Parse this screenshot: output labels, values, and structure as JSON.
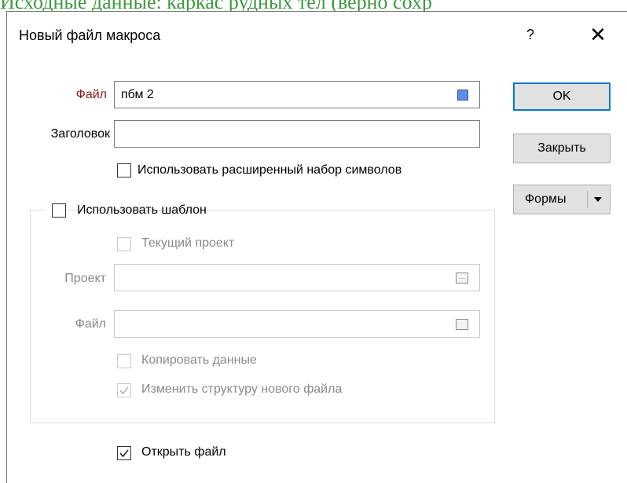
{
  "background": {
    "text": "Исходные данные: каркас рудных тел (верно сохр"
  },
  "dialog": {
    "title": "Новый файл макроса",
    "help_label": "?",
    "close_label": "✕"
  },
  "form": {
    "file_label": "Файл",
    "file_value": "пбм 2",
    "heading_label": "Заголовок",
    "heading_value": "",
    "extended_charset_label": "Использовать расширенный набор символов",
    "extended_charset_checked": false
  },
  "template": {
    "use_template_label": "Использовать шаблон",
    "use_template_checked": false,
    "current_project_label": "Текущий проект",
    "current_project_checked": false,
    "project_label": "Проект",
    "project_value": "",
    "file_label": "Файл",
    "file_value": "",
    "copy_data_label": "Копировать данные",
    "copy_data_checked": false,
    "change_structure_label": "Изменить структуру нового файла",
    "change_structure_checked": true
  },
  "open_file": {
    "label": "Открыть файл",
    "checked": true
  },
  "buttons": {
    "ok": "OK",
    "close": "Закрыть",
    "forms": "Формы"
  },
  "colors": {
    "accent": "#0078d7",
    "swatch": "#5d8ee6",
    "required_label": "#8b1a1a"
  }
}
